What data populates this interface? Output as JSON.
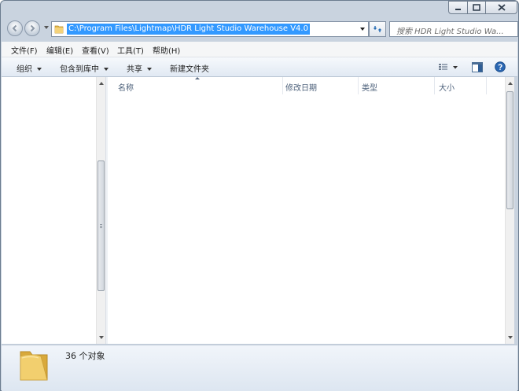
{
  "address": {
    "path": "C:\\Program Files\\Lightmap\\HDR Light Studio Warehouse V4.0"
  },
  "search": {
    "placeholder": "搜索 HDR Light Studio Wa..."
  },
  "menu": {
    "items": [
      "文件(F)",
      "编辑(E)",
      "查看(V)",
      "工具(T)",
      "帮助(H)"
    ]
  },
  "toolbar": {
    "organize": "组织",
    "include_in_library": "包含到库中",
    "share": "共享",
    "new_folder": "新建文件夹"
  },
  "columns": {
    "name": "名称",
    "date_modified": "修改日期",
    "type": "类型",
    "size": "大小"
  },
  "details": {
    "count_text": "36 个对象"
  },
  "colors": {
    "selection": "#3399ff",
    "window_frame": "#c9d3df"
  },
  "icons": [
    "back-icon",
    "forward-icon",
    "folder-icon",
    "refresh-icon",
    "search-icon",
    "view-icon",
    "preview-pane-icon",
    "help-icon"
  ]
}
